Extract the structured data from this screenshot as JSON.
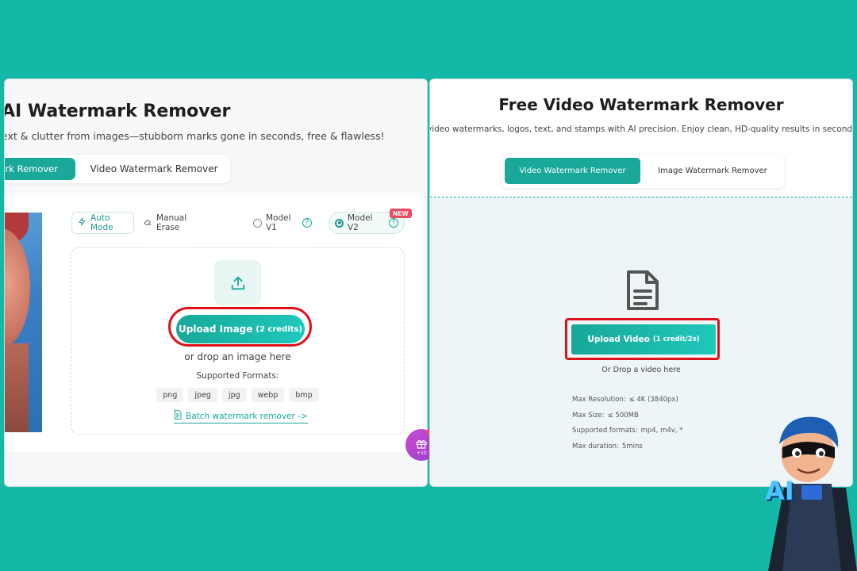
{
  "left_panel": {
    "title": "AI Watermark Remover",
    "subtitle": "ext & clutter from images—stubborn marks gone in seconds, free & flawless!",
    "tabs": [
      {
        "label": "ark Remover",
        "active": true
      },
      {
        "label": "Video Watermark Remover",
        "active": false
      }
    ],
    "modes": {
      "auto": "Auto Mode",
      "manual": "Manual Erase"
    },
    "models": [
      {
        "label": "Model V1",
        "selected": false
      },
      {
        "label": "Model V2",
        "selected": true,
        "badge": "NEW"
      }
    ],
    "help_glyph": "?",
    "upload_button": {
      "label": "Upload Image",
      "credits": "(2 credits)"
    },
    "drop_hint": "or drop an image here",
    "formats_label": "Supported Formats:",
    "formats": [
      "png",
      "jpeg",
      "jpg",
      "webp",
      "bmp"
    ],
    "batch_link": "Batch watermark remover ->",
    "gift_count": "+10"
  },
  "right_panel": {
    "title": "Free Video Watermark Remover",
    "subtitle": "video watermarks, logos, text, and stamps with AI precision. Enjoy clean, HD-quality results in seconds — no",
    "tabs": [
      {
        "label": "Video Watermark Remover",
        "active": true
      },
      {
        "label": "Image Watermark Remover",
        "active": false
      }
    ],
    "upload_button": {
      "label": "Upload Video",
      "credits": "(1 credit/2s)"
    },
    "drop_hint": "Or Drop a video here",
    "specs": [
      {
        "label": "Max Resolution:",
        "value": "≤ 4K (3840px)"
      },
      {
        "label": "Max Size:",
        "value": "≤ 500MB"
      },
      {
        "label": "Supported formats:",
        "value": "mp4, m4v, *"
      },
      {
        "label": "Max duration:",
        "value": "5mins"
      }
    ]
  },
  "mascot": {
    "chest_text": "AI"
  },
  "colors": {
    "background": "#13b9a6",
    "accent": "#1aa89b",
    "highlight_ring": "#e0101a",
    "new_badge": "#ef4a5f"
  }
}
